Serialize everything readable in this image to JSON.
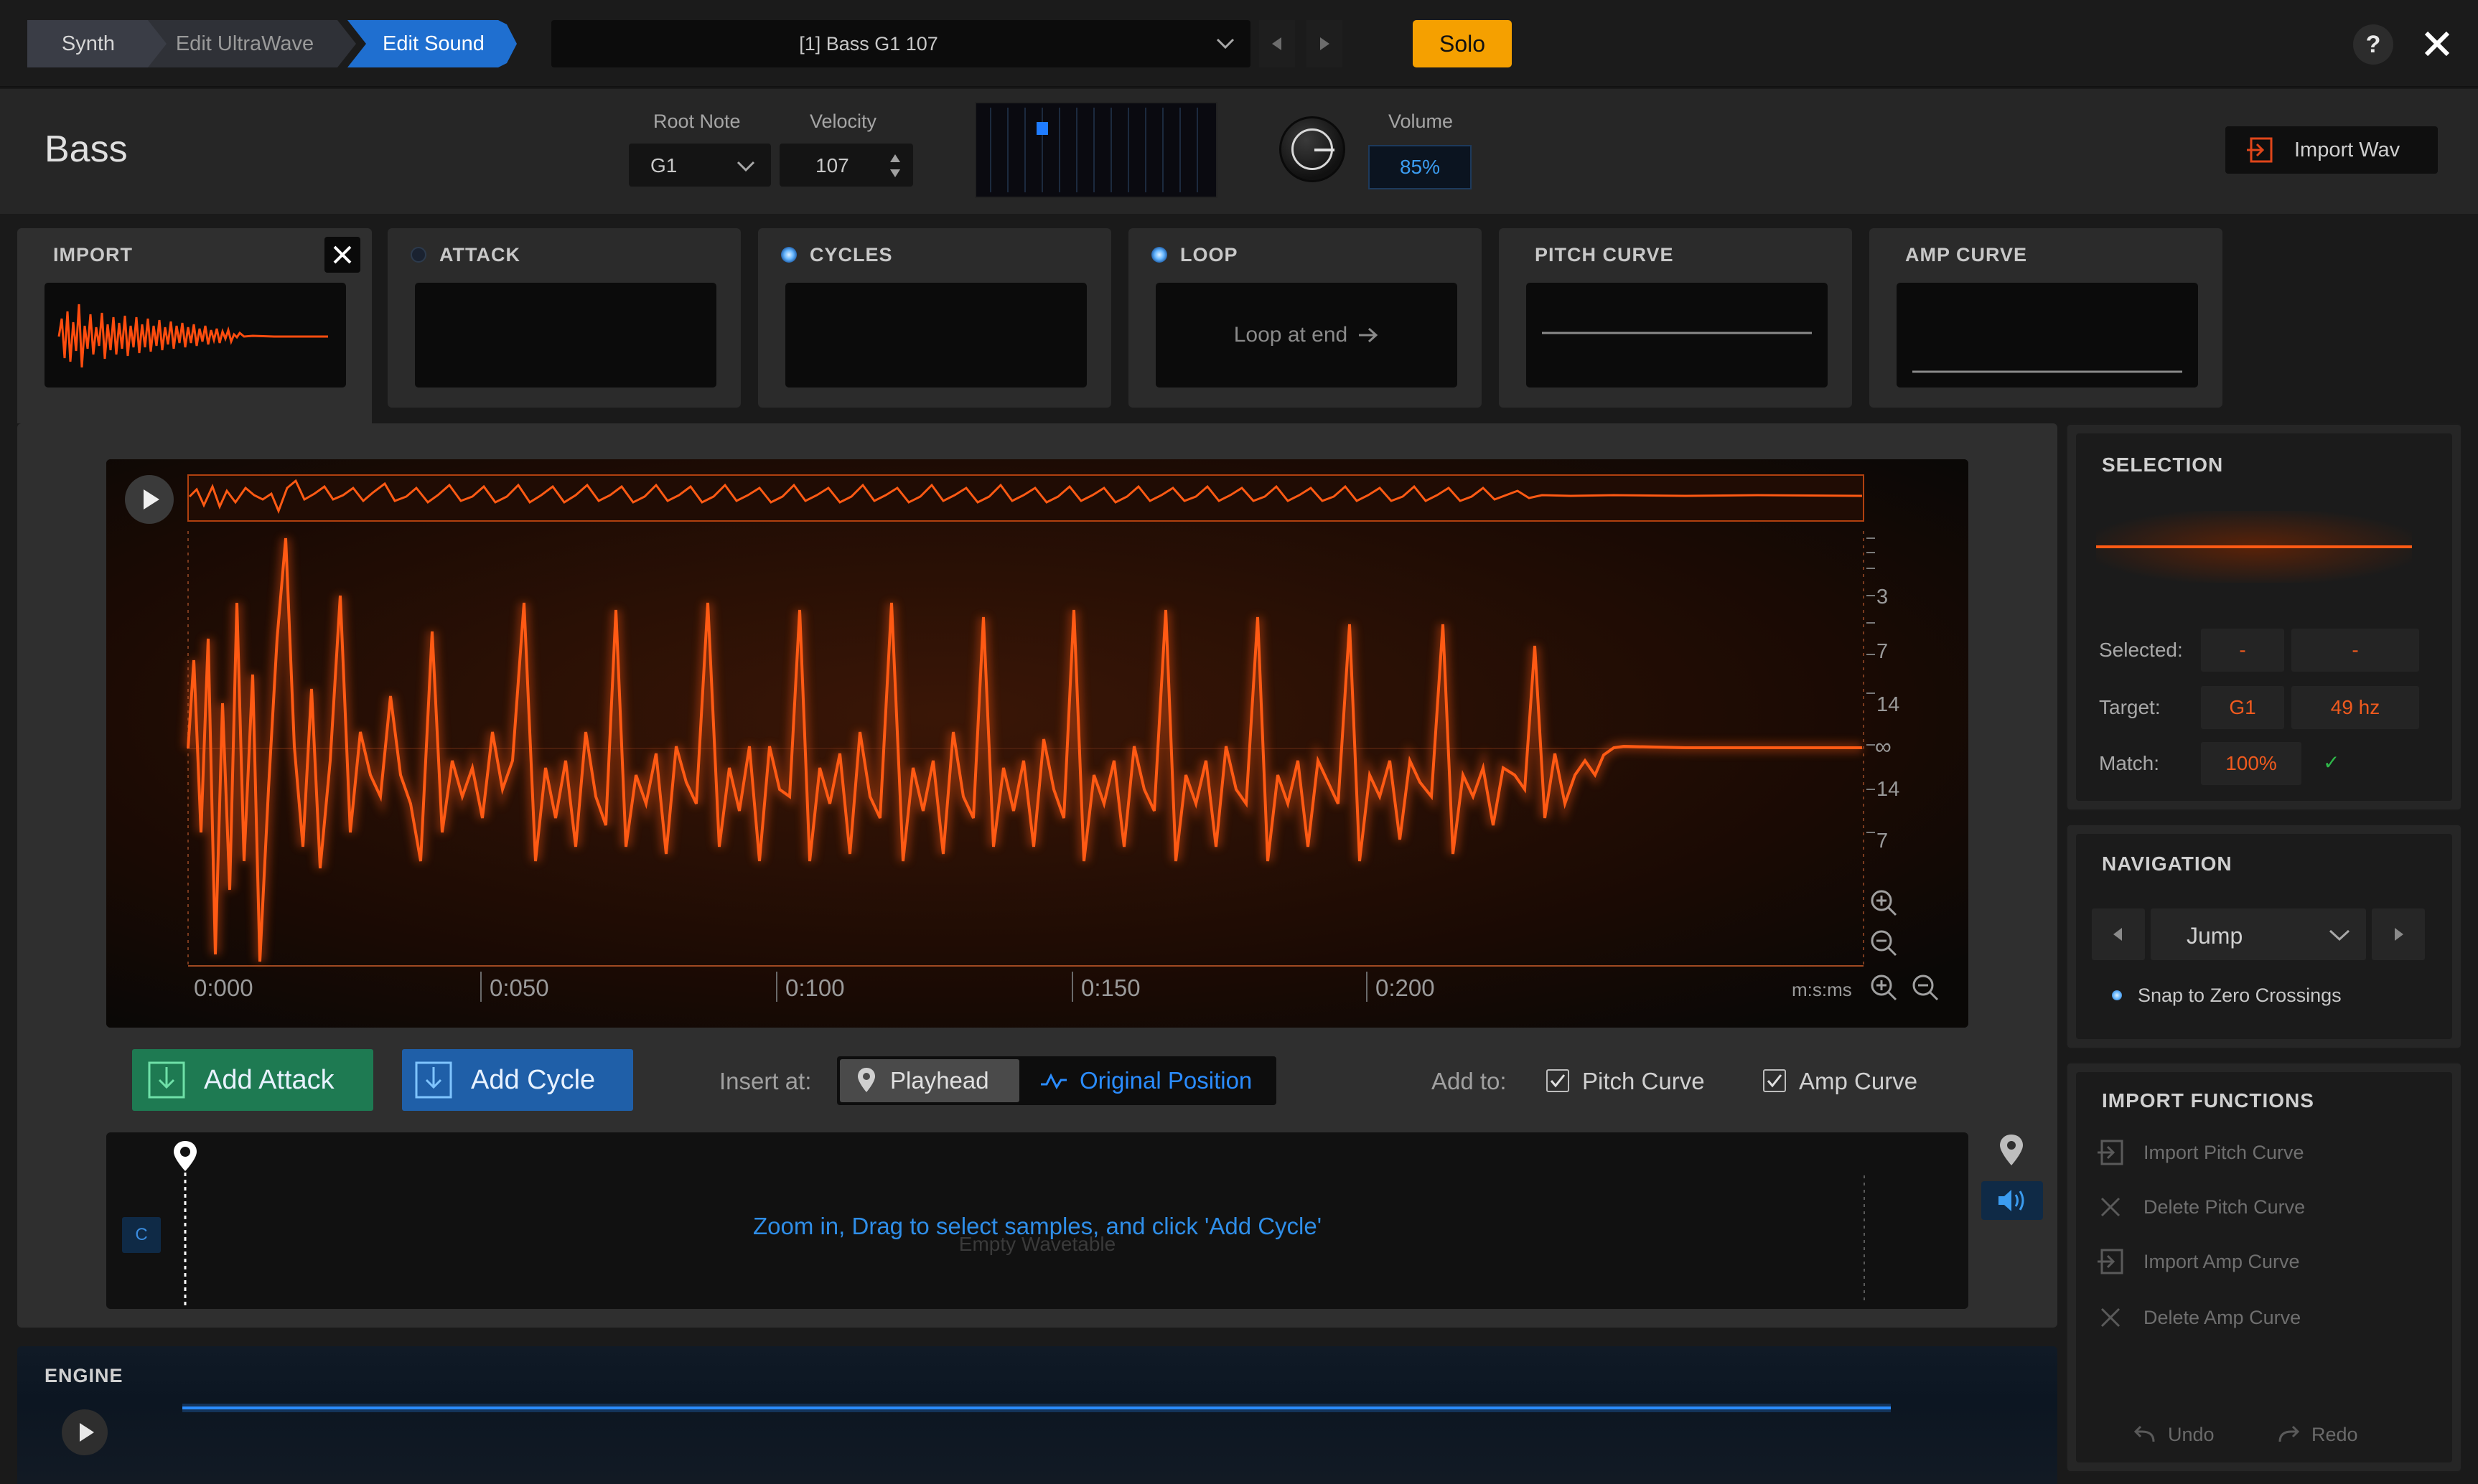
{
  "breadcrumbs": [
    {
      "label": "Synth"
    },
    {
      "label": "Edit UltraWave"
    },
    {
      "label": "Edit Sound"
    }
  ],
  "preset": {
    "label": "[1] Bass G1 107"
  },
  "solo_label": "Solo",
  "help_label": "?",
  "header": {
    "sound_name": "Bass",
    "root_note_label": "Root Note",
    "root_note_value": "G1",
    "velocity_label": "Velocity",
    "velocity_value": "107",
    "volume_label": "Volume",
    "volume_value": "85%",
    "import_wav_label": "Import Wav"
  },
  "stages": {
    "import": "IMPORT",
    "attack": "ATTACK",
    "cycles": "CYCLES",
    "loop": "LOOP",
    "loop_text": "Loop at end",
    "pitch_curve": "PITCH CURVE",
    "amp_curve": "AMP CURVE"
  },
  "waveform": {
    "time_labels": [
      "0:000",
      "0:050",
      "0:100",
      "0:150",
      "0:200"
    ],
    "db_labels": [
      "3",
      "7",
      "14",
      "∞",
      "14",
      "7"
    ],
    "time_unit": "m:s:ms"
  },
  "actions": {
    "add_attack": "Add Attack",
    "add_cycle": "Add Cycle",
    "insert_at_label": "Insert at:",
    "playhead_label": "Playhead",
    "original_position_label": "Original Position",
    "add_to_label": "Add to:",
    "pitch_curve_label": "Pitch Curve",
    "amp_curve_label": "Amp Curve"
  },
  "wavetable": {
    "hint": "Zoom in, Drag to select samples, and click 'Add Cycle'",
    "empty_label": "Empty Wavetable",
    "key_label": "C"
  },
  "engine": {
    "title": "ENGINE"
  },
  "selection": {
    "title": "SELECTION",
    "selected_label": "Selected:",
    "selected_values": [
      "-",
      "-"
    ],
    "target_label": "Target:",
    "target_note": "G1",
    "target_freq": "49 hz",
    "match_label": "Match:",
    "match_value": "100%",
    "match_ok": "✓"
  },
  "navigation": {
    "title": "NAVIGATION",
    "mode": "Jump",
    "snap_label": "Snap to Zero Crossings"
  },
  "import_functions": {
    "title": "IMPORT FUNCTIONS",
    "items": [
      "Import Pitch Curve",
      "Delete Pitch Curve",
      "Import Amp Curve",
      "Delete Amp Curve"
    ],
    "undo": "Undo",
    "redo": "Redo"
  },
  "colors": {
    "accent_blue": "#1f6fd0",
    "solo_orange": "#f5a000",
    "wave_orange": "#ff5a14",
    "add_attack_green": "#1e7a52"
  }
}
